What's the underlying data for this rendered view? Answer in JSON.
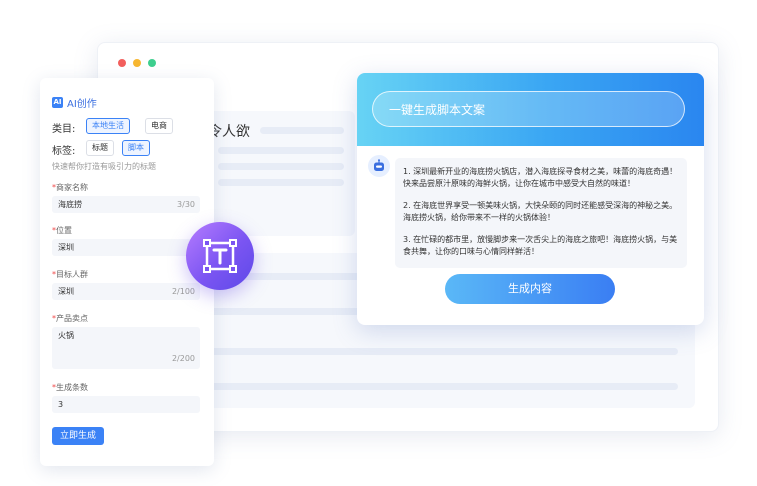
{
  "bg": {
    "text": "令人欲"
  },
  "left": {
    "brand": "AI创作",
    "brand_badge": "AI",
    "category_label": "类目:",
    "category_chips": [
      "本地生活",
      "电商"
    ],
    "tag_label": "标签:",
    "tag_chips": [
      "标题",
      "脚本"
    ],
    "hint": "快速帮你打造有吸引力的标题",
    "fields": [
      {
        "label": "商家名称",
        "value": "海底捞",
        "count": "3/30"
      },
      {
        "label": "位置",
        "value": "深圳",
        "count": "2/"
      },
      {
        "label": "目标人群",
        "value": "深圳",
        "count": "2/100"
      },
      {
        "label": "产品卖点",
        "value": "火锅",
        "count": "2/200"
      },
      {
        "label": "生成条数",
        "value": "3",
        "count": ""
      }
    ],
    "required_mark": "*",
    "submit": "立即生成"
  },
  "gen": {
    "title": "一键生成脚本文案",
    "paragraphs": [
      "1. 深圳最新开业的海底捞火锅店，潜入海底探寻食材之美，味蕾的海底奇遇！快来品尝原汁原味的海鲜火锅，让你在城市中感受大自然的味道！",
      "2. 在海底世界享受一顿美味火锅，大快朵颐的同时还能感受深海的神秘之美。海底捞火锅，给你带来不一样的火锅体验！",
      "3. 在忙碌的都市里，放慢脚步来一次舌尖上的海底之旅吧！海底捞火锅，与美食共舞，让你的口味与心情同样鲜活！"
    ],
    "button": "生成内容"
  }
}
